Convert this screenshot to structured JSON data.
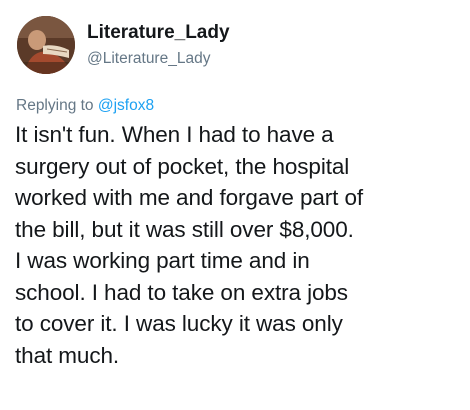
{
  "author": {
    "display_name": "Literature_Lady",
    "handle": "@Literature_Lady",
    "avatar_icon": "profile-photo"
  },
  "reply": {
    "prefix": "Replying to",
    "mention": "@jsfox8"
  },
  "tweet": {
    "lines": [
      "It isn't fun. When I had to have a",
      "surgery out of pocket, the hospital",
      "worked with me and forgave part of",
      "the bill, but it was still over $8,000.",
      "I was working part time and in",
      "school. I had to take on extra jobs",
      "to cover it. I was lucky it was only",
      "that much."
    ]
  },
  "colors": {
    "text": "#14171a",
    "secondary": "#657786",
    "link": "#1da1f2"
  }
}
